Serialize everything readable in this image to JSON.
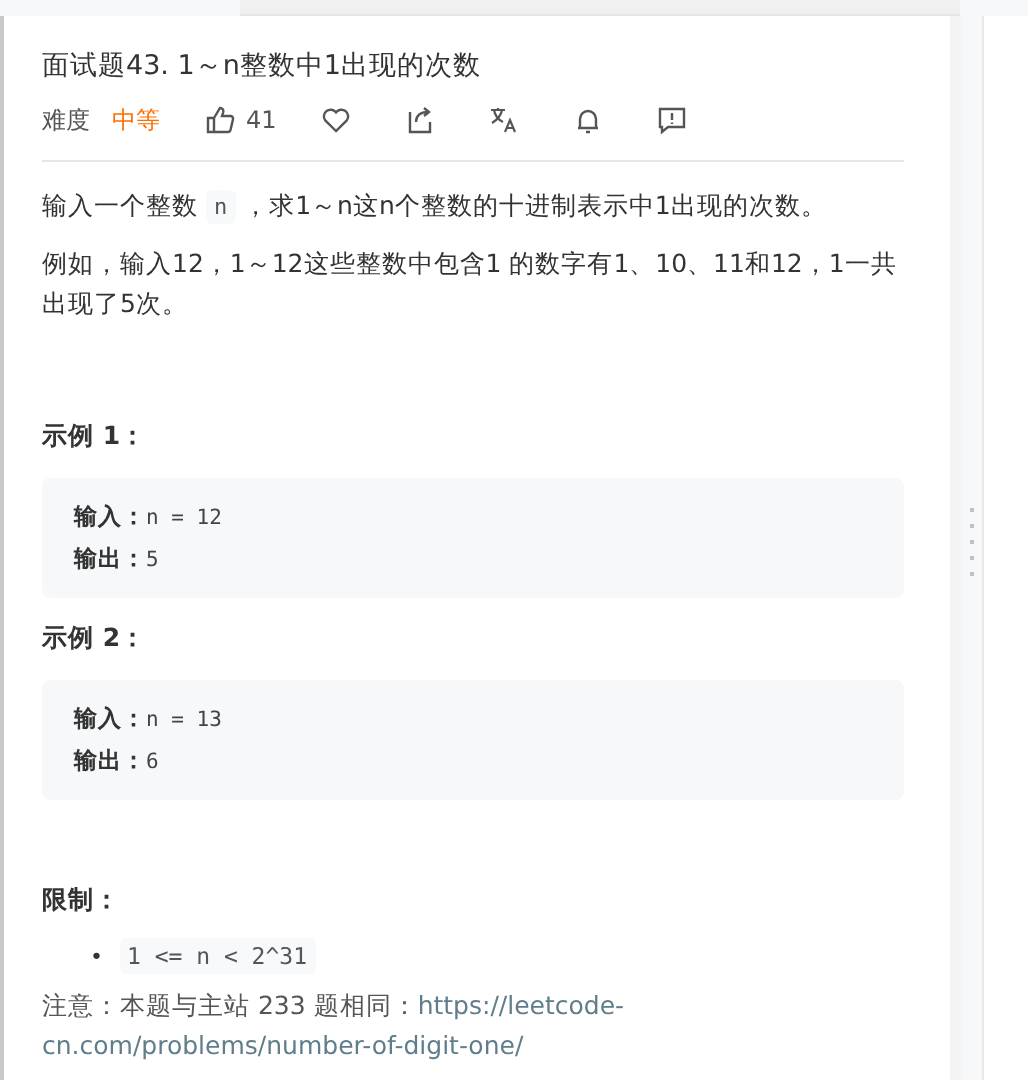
{
  "title": "面试题43. 1～n整数中1出现的次数",
  "meta": {
    "difficulty_label": "难度",
    "difficulty": "中等",
    "likes": "41"
  },
  "actions": [
    {
      "kind": "like"
    },
    {
      "kind": "favorite"
    },
    {
      "kind": "share"
    },
    {
      "kind": "translate"
    },
    {
      "kind": "notify"
    },
    {
      "kind": "feedback"
    }
  ],
  "description": {
    "before": "输入一个整数",
    "code": "n",
    "after": "，求1～n这n个整数的十进制表示中1出现的次数。"
  },
  "example_text": "例如，输入12，1～12这些整数中包含1 的数字有1、10、11和12，1一共出现了5次。",
  "examples": [
    {
      "title": "示例 1：",
      "input_label": "输入：",
      "input": "n = 12",
      "output_label": "输出：",
      "output": "5"
    },
    {
      "title": "示例 2：",
      "input_label": "输入：",
      "input": "n = 13",
      "output_label": "输出：",
      "output": "6"
    }
  ],
  "constraints_title": "限制：",
  "constraints": [
    {
      "bullet": "•",
      "code": "1 <= n <  2^31"
    }
  ],
  "note": {
    "text": "注意：本题与主站 233 题相同：",
    "link_lines": [
      "https://leetcode-",
      "cn.com/problems/number-of-digit-one/"
    ]
  }
}
